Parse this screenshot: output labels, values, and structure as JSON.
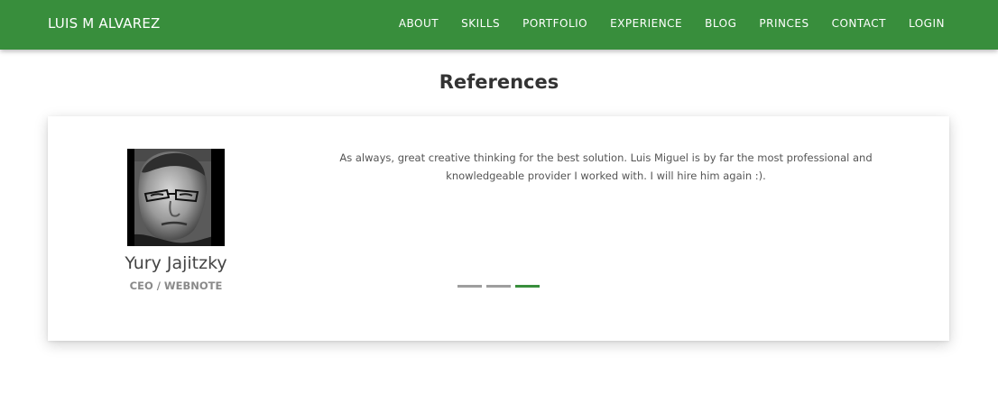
{
  "navbar": {
    "brand": "LUIS M ALVAREZ",
    "items": [
      "ABOUT",
      "SKILLS",
      "PORTFOLIO",
      "EXPERIENCE",
      "BLOG",
      "PRINCES",
      "CONTACT",
      "LOGIN"
    ]
  },
  "references": {
    "title": "References",
    "testimonial": {
      "quote": "As always, great creative thinking for the best solution. Luis Miguel is by far the most professional and knowledgeable provider I worked with. I will hire him again :).",
      "name": "Yury Jajitzky",
      "role": "CEO / WEBNOTE"
    },
    "slide_count": 3,
    "active_slide": 3
  },
  "colors": {
    "brand": "#388e3c",
    "indicator_inactive": "#9e9e9e",
    "indicator_active": "#388e3c"
  }
}
